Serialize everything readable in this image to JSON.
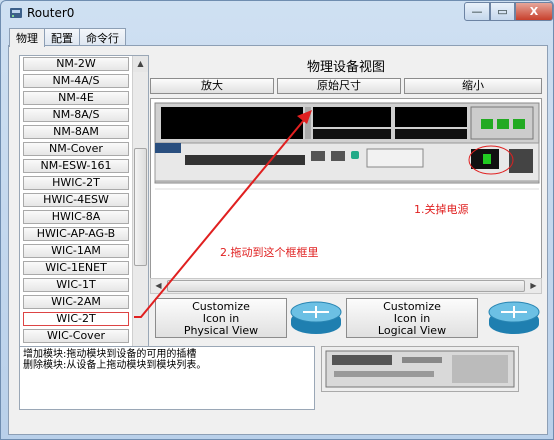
{
  "window": {
    "title": "Router0",
    "close_symbol": "X",
    "min_symbol": "—",
    "max_symbol": "▭"
  },
  "tabs": [
    {
      "label": "物理"
    },
    {
      "label": "配置"
    },
    {
      "label": "命令行"
    }
  ],
  "modules": [
    "NM-2W",
    "NM-4A/S",
    "NM-4E",
    "NM-8A/S",
    "NM-8AM",
    "NM-Cover",
    "NM-ESW-161",
    "HWIC-2T",
    "HWIC-4ESW",
    "HWIC-8A",
    "HWIC-AP-AG-B",
    "WIC-1AM",
    "WIC-1ENET",
    "WIC-1T",
    "WIC-2AM",
    "WIC-2T",
    "WIC-Cover"
  ],
  "view": {
    "title": "物理设备视图",
    "zoom_in": "放大",
    "actual_size": "原始尺寸",
    "zoom_out": "缩小"
  },
  "buttons": {
    "physical": [
      "Customize",
      "Icon in",
      "Physical View"
    ],
    "logical": [
      "Customize",
      "Icon in",
      "Logical View"
    ]
  },
  "info": {
    "line1": "增加模块:拖动模块到设备的可用的插槽",
    "line2": "删除模块:从设备上拖动模块到模块列表。"
  },
  "annotations": {
    "power": "1.关掉电源",
    "drag": "2.拖动到这个框框里"
  },
  "colors": {
    "annotation": "#e02020",
    "panel": "#f0f0f0"
  }
}
